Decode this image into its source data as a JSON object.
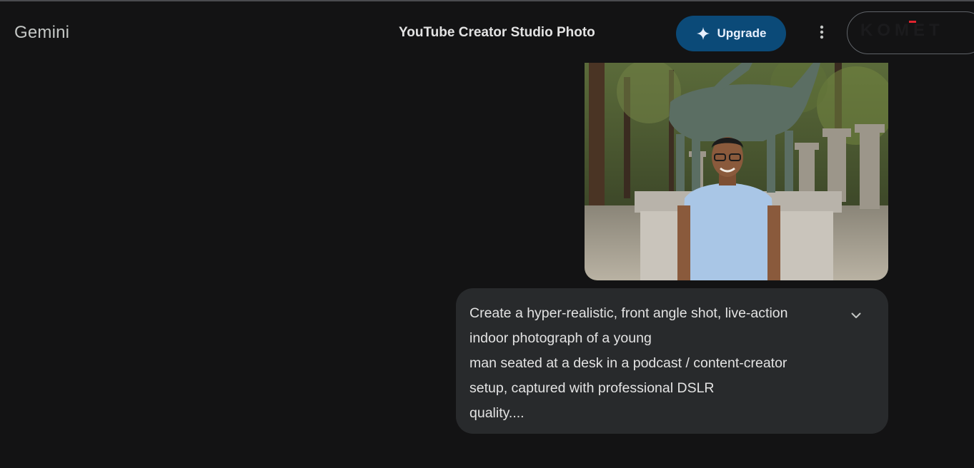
{
  "header": {
    "brand": "Gemini",
    "chat_title": "YouTube Creator Studio Photo",
    "upgrade_label": "Upgrade",
    "upgrade_icon": "sparkle-icon",
    "more_icon": "more-vert-icon",
    "account_logo": "KOMET",
    "account_accent_color": "#e0242f"
  },
  "message": {
    "image_alt": "man in light blue t-shirt with glasses standing in front of a bronze deer statue",
    "text_lines": [
      "Create a hyper-realistic, front angle shot, live-action",
      "indoor photograph of a young",
      "man seated at a desk in a podcast / content-creator",
      "setup, captured with professional DSLR",
      "quality...."
    ],
    "expand_icon": "chevron-down-icon"
  },
  "colors": {
    "background": "#131314",
    "bubble": "#282a2c",
    "upgrade_button": "#0b4a78"
  }
}
